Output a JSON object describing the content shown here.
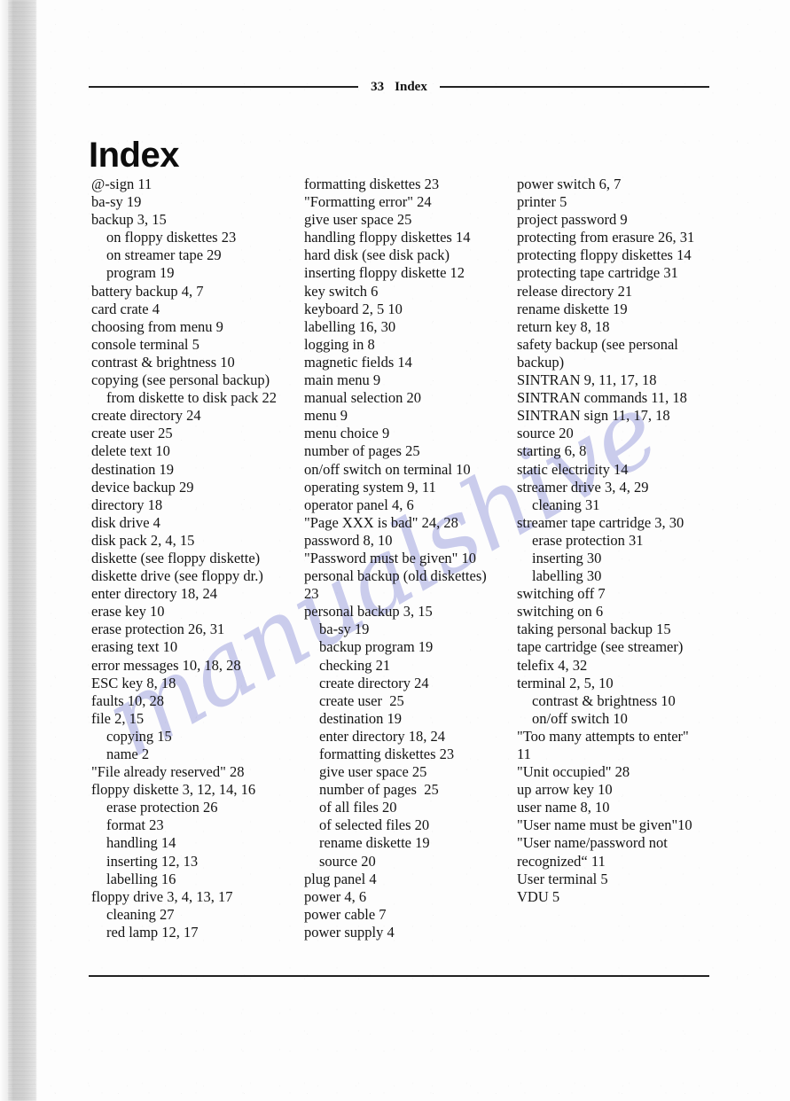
{
  "page": {
    "title": "Index",
    "running_head": {
      "page_number": "33",
      "section": "Index"
    },
    "watermark_text": "manualshive",
    "watermark_color": "#b7bae6"
  },
  "columns": [
    {
      "id": "column-1",
      "entries": [
        {
          "text": "@-sign 11",
          "level": 0
        },
        {
          "text": "ba-sy 19",
          "level": 0
        },
        {
          "text": "backup 3, 15",
          "level": 0
        },
        {
          "text": "on floppy diskettes 23",
          "level": 1
        },
        {
          "text": "on streamer tape 29",
          "level": 1
        },
        {
          "text": "program 19",
          "level": 1
        },
        {
          "text": "battery backup 4, 7",
          "level": 0
        },
        {
          "text": "card crate 4",
          "level": 0
        },
        {
          "text": "choosing from menu 9",
          "level": 0
        },
        {
          "text": "console terminal 5",
          "level": 0
        },
        {
          "text": "contrast & brightness 10",
          "level": 0
        },
        {
          "text": "copying (see personal backup)",
          "level": 0
        },
        {
          "text": "from diskette to disk pack 22",
          "level": 1
        },
        {
          "text": "create directory 24",
          "level": 0
        },
        {
          "text": "create user 25",
          "level": 0
        },
        {
          "text": "delete text 10",
          "level": 0
        },
        {
          "text": "destination 19",
          "level": 0
        },
        {
          "text": "device backup 29",
          "level": 0
        },
        {
          "text": "directory 18",
          "level": 0
        },
        {
          "text": "disk drive 4",
          "level": 0
        },
        {
          "text": "disk pack 2, 4, 15",
          "level": 0
        },
        {
          "text": "diskette (see floppy diskette)",
          "level": 0
        },
        {
          "text": "diskette drive (see floppy dr.)",
          "level": 0
        },
        {
          "text": "enter directory 18, 24",
          "level": 0
        },
        {
          "text": "erase key 10",
          "level": 0
        },
        {
          "text": "erase protection 26, 31",
          "level": 0
        },
        {
          "text": "erasing text 10",
          "level": 0
        },
        {
          "text": "error messages 10, 18, 28",
          "level": 0
        },
        {
          "text": "ESC key 8, 18",
          "level": 0
        },
        {
          "text": "faults 10, 28",
          "level": 0
        },
        {
          "text": "file 2, 15",
          "level": 0
        },
        {
          "text": "copying 15",
          "level": 1
        },
        {
          "text": "name 2",
          "level": 1
        },
        {
          "text": "\"File already reserved\" 28",
          "level": 0
        },
        {
          "text": "floppy diskette 3, 12, 14, 16",
          "level": 0
        },
        {
          "text": "erase protection 26",
          "level": 1
        },
        {
          "text": "format 23",
          "level": 1
        },
        {
          "text": "handling 14",
          "level": 1
        },
        {
          "text": "inserting 12, 13",
          "level": 1
        },
        {
          "text": "labelling 16",
          "level": 1
        },
        {
          "text": "floppy drive 3, 4, 13, 17",
          "level": 0
        },
        {
          "text": "cleaning 27",
          "level": 1
        },
        {
          "text": "red lamp 12, 17",
          "level": 1
        }
      ]
    },
    {
      "id": "column-2",
      "entries": [
        {
          "text": "formatting diskettes 23",
          "level": 0
        },
        {
          "text": "\"Formatting error\" 24",
          "level": 0
        },
        {
          "text": "give user space 25",
          "level": 0
        },
        {
          "text": "handling floppy diskettes 14",
          "level": 0
        },
        {
          "text": "hard disk (see disk pack)",
          "level": 0
        },
        {
          "text": "inserting floppy diskette 12",
          "level": 0
        },
        {
          "text": "key switch 6",
          "level": 0
        },
        {
          "text": "keyboard 2, 5 10",
          "level": 0
        },
        {
          "text": "labelling 16, 30",
          "level": 0
        },
        {
          "text": "logging in 8",
          "level": 0
        },
        {
          "text": "magnetic fields 14",
          "level": 0
        },
        {
          "text": "main menu 9",
          "level": 0
        },
        {
          "text": "manual selection 20",
          "level": 0
        },
        {
          "text": "menu 9",
          "level": 0
        },
        {
          "text": "menu choice 9",
          "level": 0
        },
        {
          "text": "number of pages 25",
          "level": 0
        },
        {
          "text": "on/off switch on terminal 10",
          "level": 0
        },
        {
          "text": "operating system 9, 11",
          "level": 0
        },
        {
          "text": "operator panel 4, 6",
          "level": 0
        },
        {
          "text": "\"Page XXX is bad\" 24, 28",
          "level": 0
        },
        {
          "text": "password 8, 10",
          "level": 0
        },
        {
          "text": "\"Password must be given\" 10",
          "level": 0
        },
        {
          "text": "personal backup (old diskettes)",
          "level": 0
        },
        {
          "text": "23",
          "level": 0
        },
        {
          "text": "personal backup 3, 15",
          "level": 0
        },
        {
          "text": "ba-sy 19",
          "level": 1
        },
        {
          "text": "backup program 19",
          "level": 1
        },
        {
          "text": "checking 21",
          "level": 1
        },
        {
          "text": "create directory 24",
          "level": 1
        },
        {
          "text": "create user  25",
          "level": 1
        },
        {
          "text": "destination 19",
          "level": 1
        },
        {
          "text": "enter directory 18, 24",
          "level": 1
        },
        {
          "text": "formatting diskettes 23",
          "level": 1
        },
        {
          "text": "give user space 25",
          "level": 1
        },
        {
          "text": "number of pages  25",
          "level": 1
        },
        {
          "text": "of all files 20",
          "level": 1
        },
        {
          "text": "of selected files 20",
          "level": 1
        },
        {
          "text": "rename diskette 19",
          "level": 1
        },
        {
          "text": "source 20",
          "level": 1
        },
        {
          "text": "plug panel 4",
          "level": 0
        },
        {
          "text": "power 4, 6",
          "level": 0
        },
        {
          "text": "power cable 7",
          "level": 0
        },
        {
          "text": "power supply 4",
          "level": 0
        }
      ]
    },
    {
      "id": "column-3",
      "entries": [
        {
          "text": "power switch 6, 7",
          "level": 0
        },
        {
          "text": "printer 5",
          "level": 0
        },
        {
          "text": "project password 9",
          "level": 0
        },
        {
          "text": "protecting from erasure 26, 31",
          "level": 0
        },
        {
          "text": "protecting floppy diskettes 14",
          "level": 0
        },
        {
          "text": "protecting tape cartridge 31",
          "level": 0
        },
        {
          "text": "release directory 21",
          "level": 0
        },
        {
          "text": "rename diskette 19",
          "level": 0
        },
        {
          "text": "return key 8, 18",
          "level": 0
        },
        {
          "text": "safety backup (see personal",
          "level": 0
        },
        {
          "text": "backup)",
          "level": 0
        },
        {
          "text": "SINTRAN 9, 11, 17, 18",
          "level": 0
        },
        {
          "text": "SINTRAN commands 11, 18",
          "level": 0
        },
        {
          "text": "SINTRAN sign 11, 17, 18",
          "level": 0
        },
        {
          "text": "source 20",
          "level": 0
        },
        {
          "text": "starting 6, 8",
          "level": 0
        },
        {
          "text": "static electricity 14",
          "level": 0
        },
        {
          "text": "streamer drive 3, 4, 29",
          "level": 0
        },
        {
          "text": "cleaning 31",
          "level": 1
        },
        {
          "text": "streamer tape cartridge 3, 30",
          "level": 0
        },
        {
          "text": "erase protection 31",
          "level": 1
        },
        {
          "text": "inserting 30",
          "level": 1
        },
        {
          "text": "labelling 30",
          "level": 1
        },
        {
          "text": "switching off 7",
          "level": 0
        },
        {
          "text": "switching on 6",
          "level": 0
        },
        {
          "text": "taking personal backup 15",
          "level": 0
        },
        {
          "text": "tape cartridge (see streamer)",
          "level": 0
        },
        {
          "text": "telefix 4, 32",
          "level": 0
        },
        {
          "text": "terminal 2, 5, 10",
          "level": 0
        },
        {
          "text": "contrast & brightness 10",
          "level": 1
        },
        {
          "text": "on/off switch 10",
          "level": 1
        },
        {
          "text": "\"Too many attempts to enter\"",
          "level": 0
        },
        {
          "text": "11",
          "level": 0
        },
        {
          "text": "\"Unit occupied\" 28",
          "level": 0
        },
        {
          "text": "up arrow key 10",
          "level": 0
        },
        {
          "text": "user name 8, 10",
          "level": 0
        },
        {
          "text": "\"User name must be given\"10",
          "level": 0
        },
        {
          "text": "\"User name/password not",
          "level": 0
        },
        {
          "text": "recognized“ 11",
          "level": 0
        },
        {
          "text": "User terminal 5",
          "level": 0
        },
        {
          "text": "VDU 5",
          "level": 0
        }
      ]
    }
  ]
}
